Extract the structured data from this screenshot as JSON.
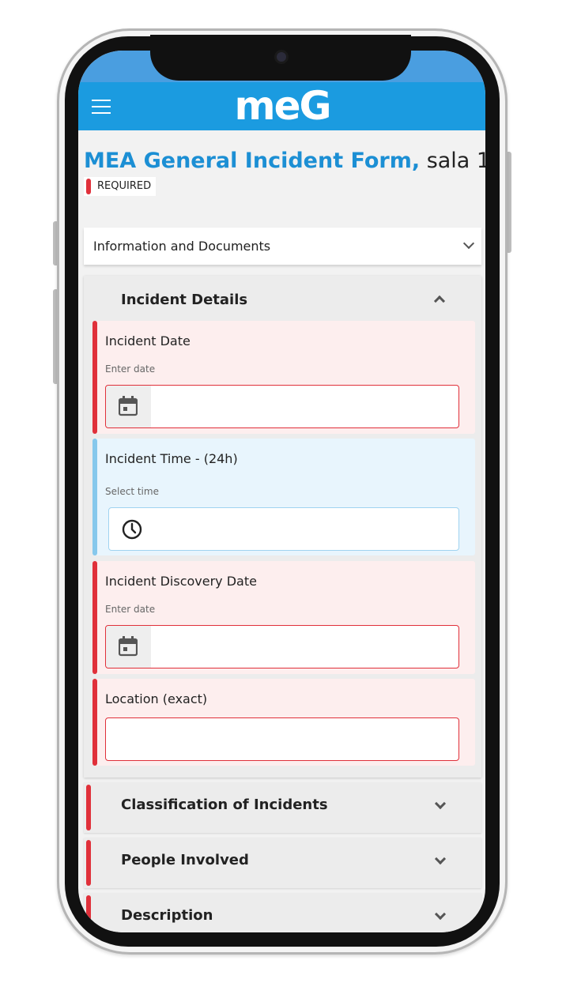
{
  "app": {
    "logo_text": "meG",
    "brand_color": "#1b9be0",
    "required_color": "#e0303a"
  },
  "header": {
    "menu_icon": "hamburger-menu-icon"
  },
  "page": {
    "title": "MEA General Incident Form,",
    "subtitle": " sala 1",
    "required_label": "REQUIRED"
  },
  "info_bar": {
    "label": "Information and Documents",
    "icon": "chevron-down-icon"
  },
  "incident_details": {
    "title": "Incident Details",
    "icon": "chevron-up-icon",
    "fields": [
      {
        "label": "Incident Date",
        "hint": "Enter date",
        "icon": "calendar-icon",
        "required": true,
        "value": ""
      },
      {
        "label": "Incident Time - (24h)",
        "hint": "Select time",
        "icon": "clock-icon",
        "required": false,
        "value": ""
      },
      {
        "label": "Incident Discovery Date",
        "hint": "Enter date",
        "icon": "calendar-icon",
        "required": true,
        "value": ""
      },
      {
        "label": "Location (exact)",
        "required": true,
        "value": ""
      }
    ]
  },
  "sections": [
    {
      "label": "Classification of Incidents",
      "required": true
    },
    {
      "label": "People Involved",
      "required": true
    },
    {
      "label": "Description",
      "required": true
    }
  ]
}
